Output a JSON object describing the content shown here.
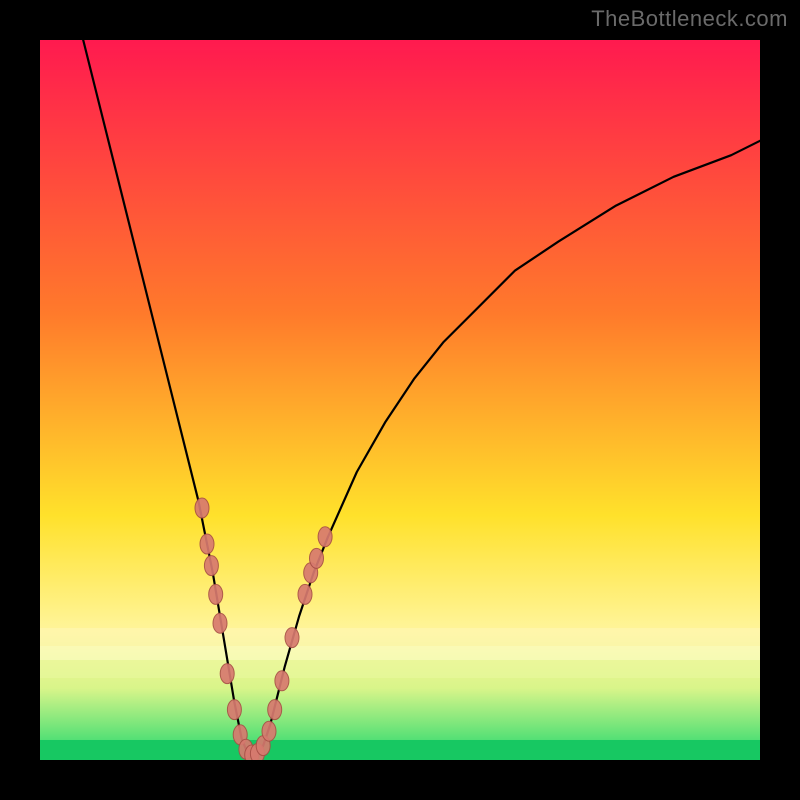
{
  "attribution": "TheBottleneck.com",
  "colors": {
    "gradient_top": "#ff1a4f",
    "gradient_mid1": "#ff7a2b",
    "gradient_mid2": "#ffe12b",
    "gradient_band_pale": "#fff59a",
    "gradient_band_soft": "#d9f58a",
    "gradient_bottom": "#1fd86d",
    "curve": "#000000",
    "marker_fill": "#d77a6f",
    "marker_stroke": "#a84f46",
    "frame": "#000000"
  },
  "chart_data": {
    "type": "line",
    "title": "",
    "xlabel": "",
    "ylabel": "",
    "xlim": [
      0,
      100
    ],
    "ylim": [
      0,
      100
    ],
    "x_optimum": 29,
    "curve": {
      "x": [
        6,
        8,
        10,
        12,
        14,
        16,
        18,
        20,
        22,
        24,
        25,
        26,
        27,
        28,
        29,
        30,
        31,
        32,
        33,
        34,
        36,
        38,
        40,
        44,
        48,
        52,
        56,
        60,
        66,
        72,
        80,
        88,
        96,
        100
      ],
      "y": [
        100,
        92,
        84,
        76,
        68,
        60,
        52,
        44,
        36,
        26,
        20,
        14,
        8,
        3,
        0.5,
        0.5,
        2,
        5,
        9,
        13,
        20,
        26,
        31,
        40,
        47,
        53,
        58,
        62,
        68,
        72,
        77,
        81,
        84,
        86
      ]
    },
    "series": [
      {
        "name": "markers",
        "points": [
          {
            "x": 22.5,
            "y": 35
          },
          {
            "x": 23.2,
            "y": 30
          },
          {
            "x": 23.8,
            "y": 27
          },
          {
            "x": 24.4,
            "y": 23
          },
          {
            "x": 25.0,
            "y": 19
          },
          {
            "x": 26.0,
            "y": 12
          },
          {
            "x": 27.0,
            "y": 7
          },
          {
            "x": 27.8,
            "y": 3.5
          },
          {
            "x": 28.6,
            "y": 1.5
          },
          {
            "x": 29.4,
            "y": 0.7
          },
          {
            "x": 30.2,
            "y": 0.9
          },
          {
            "x": 31.0,
            "y": 2
          },
          {
            "x": 31.8,
            "y": 4
          },
          {
            "x": 32.6,
            "y": 7
          },
          {
            "x": 33.6,
            "y": 11
          },
          {
            "x": 35.0,
            "y": 17
          },
          {
            "x": 36.8,
            "y": 23
          },
          {
            "x": 37.6,
            "y": 26
          },
          {
            "x": 38.4,
            "y": 28
          },
          {
            "x": 39.6,
            "y": 31
          }
        ]
      }
    ]
  }
}
